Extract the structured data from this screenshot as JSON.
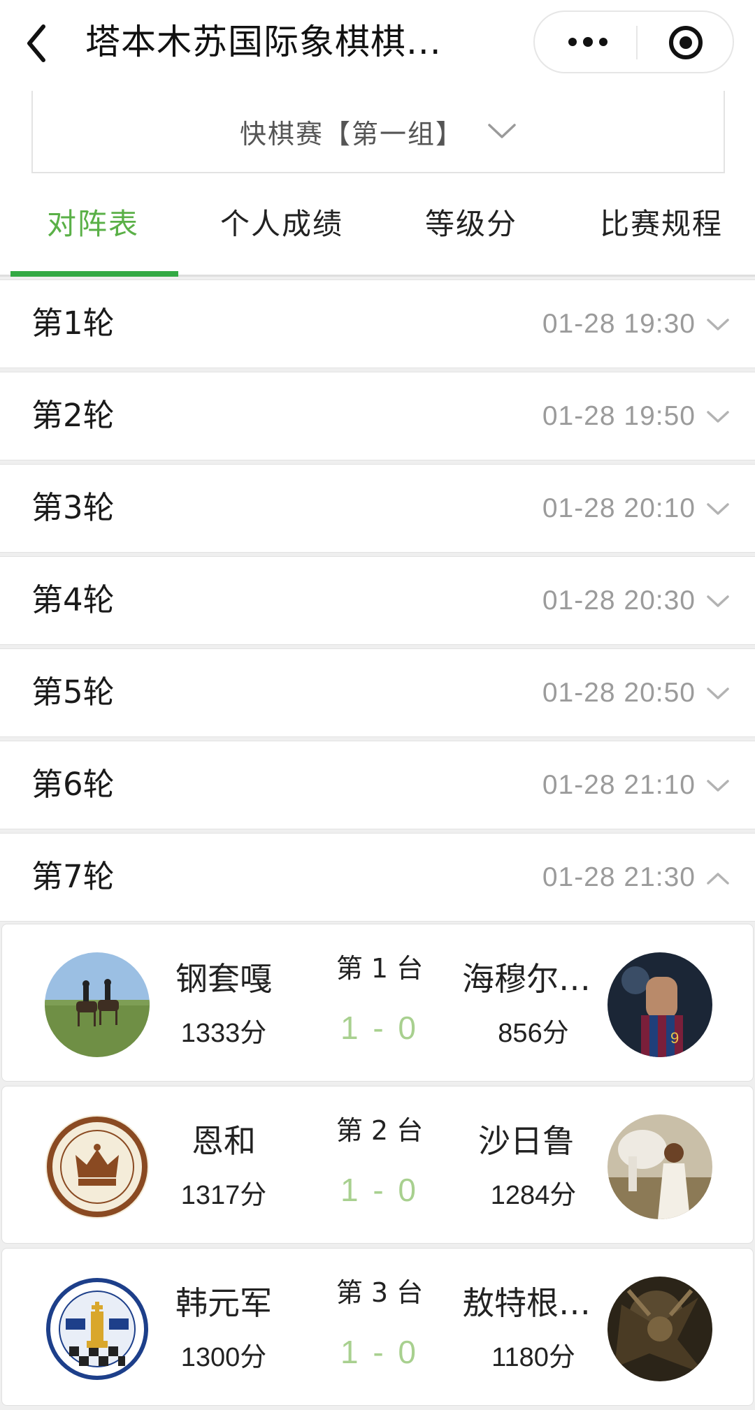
{
  "header": {
    "title": "塔本木苏国际象棋棋...",
    "back_icon": "chevron-left-icon",
    "more_icon": "more-dots-icon",
    "close_icon": "target-close-icon"
  },
  "group_selector": {
    "label": "快棋赛【第一组】",
    "icon": "chevron-down-icon"
  },
  "tabs": [
    {
      "label": "对阵表",
      "active": true
    },
    {
      "label": "个人成绩",
      "active": false
    },
    {
      "label": "等级分",
      "active": false
    },
    {
      "label": "比赛规程",
      "active": false
    }
  ],
  "colors": {
    "accent_green": "#33a944",
    "tab_active_text": "#5ab047",
    "result_green": "#a8d08f",
    "time_gray": "#9b9b9b"
  },
  "rounds": [
    {
      "name": "第1轮",
      "time": "01-28 19:30",
      "expanded": false
    },
    {
      "name": "第2轮",
      "time": "01-28 19:50",
      "expanded": false
    },
    {
      "name": "第3轮",
      "time": "01-28 20:10",
      "expanded": false
    },
    {
      "name": "第4轮",
      "time": "01-28 20:30",
      "expanded": false
    },
    {
      "name": "第5轮",
      "time": "01-28 20:50",
      "expanded": false
    },
    {
      "name": "第6轮",
      "time": "01-28 21:10",
      "expanded": false
    },
    {
      "name": "第7轮",
      "time": "01-28 21:30",
      "expanded": true
    }
  ],
  "matches": [
    {
      "board": "第 1 台",
      "result": "1 - 0",
      "white": {
        "name": "钢套嘎",
        "score": "1333分",
        "avatar": "horse-riders-photo"
      },
      "black": {
        "name": "海穆尔…",
        "score": "856分",
        "avatar": "football-player-photo"
      }
    },
    {
      "board": "第 2 台",
      "result": "1 - 0",
      "white": {
        "name": "恩和",
        "score": "1317分",
        "avatar": "chess-club-crown-logo"
      },
      "black": {
        "name": "沙日鲁",
        "score": "1284分",
        "avatar": "woman-with-horse-photo"
      }
    },
    {
      "board": "第 3 台",
      "result": "1 - 0",
      "white": {
        "name": "韩元军",
        "score": "1300分",
        "avatar": "chess-king-badge-logo"
      },
      "black": {
        "name": "敖特根…",
        "score": "1180分",
        "avatar": "dark-fantasy-art"
      }
    }
  ]
}
